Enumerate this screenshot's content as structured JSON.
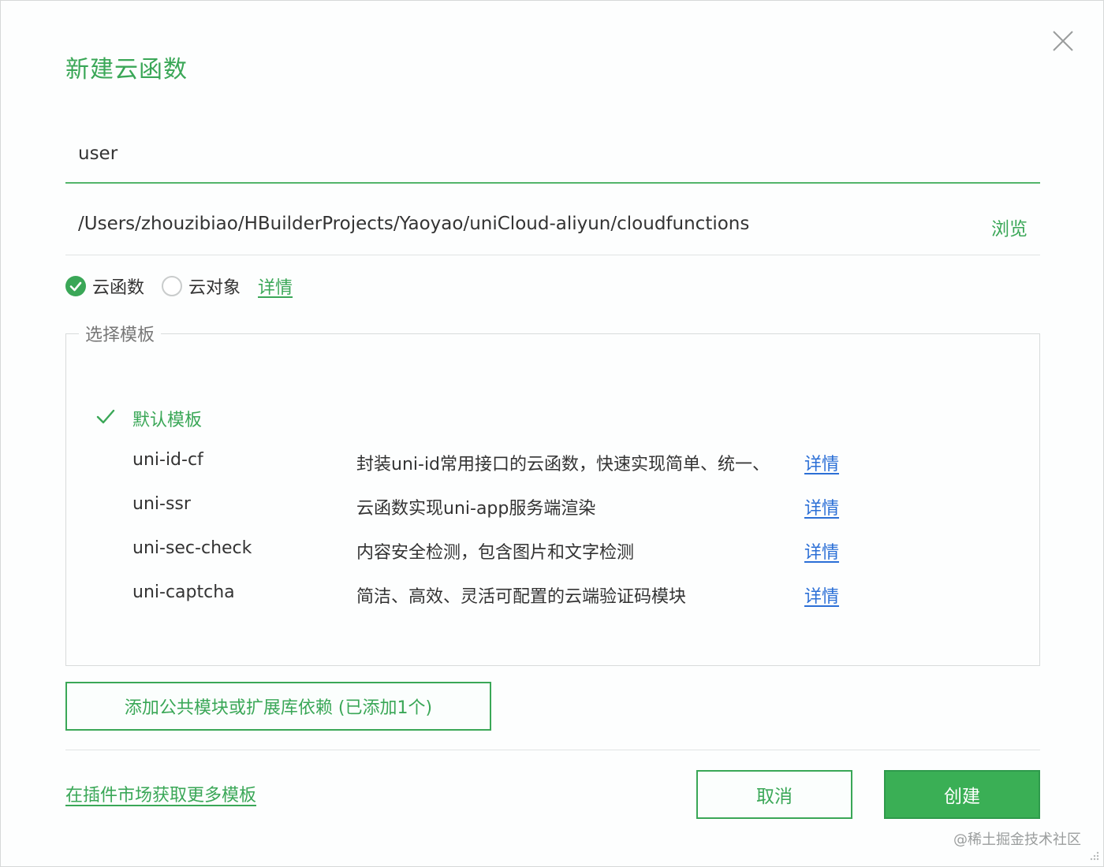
{
  "dialog": {
    "title": "新建云函数",
    "name_value": "user",
    "path": "/Users/zhouzibiao/HBuilderProjects/Yaoyao/uniCloud-aliyun/cloudfunctions",
    "browse_label": "浏览"
  },
  "type_options": [
    {
      "label": "云函数",
      "checked": true
    },
    {
      "label": "云对象",
      "checked": false
    }
  ],
  "type_detail_label": "详情",
  "templates": {
    "legend": "选择模板",
    "items": [
      {
        "name": "默认模板",
        "desc": "",
        "link": "",
        "selected": true
      },
      {
        "name": "uni-id-cf",
        "desc": "封装uni-id常用接口的云函数，快速实现简单、统一、",
        "link": "详情",
        "selected": false
      },
      {
        "name": "uni-ssr",
        "desc": "云函数实现uni-app服务端渲染",
        "link": "详情",
        "selected": false
      },
      {
        "name": "uni-sec-check",
        "desc": "内容安全检测，包含图片和文字检测",
        "link": "详情",
        "selected": false
      },
      {
        "name": "uni-captcha",
        "desc": "简洁、高效、灵活可配置的云端验证码模块",
        "link": "详情",
        "selected": false
      }
    ]
  },
  "add_dependency_label": "添加公共模块或扩展库依赖 (已添加1个)",
  "market_link_label": "在插件市场获取更多模板",
  "buttons": {
    "cancel": "取消",
    "create": "创建"
  },
  "watermark": "@稀土掘金技术社区",
  "icons": {
    "close": "close-icon",
    "radio_checked": "check-circle-icon",
    "template_selected": "checkmark-icon",
    "resize": "resize-grip-icon"
  },
  "colors": {
    "accent": "#3aa757",
    "link": "#2b6fd6",
    "text": "#333333"
  }
}
